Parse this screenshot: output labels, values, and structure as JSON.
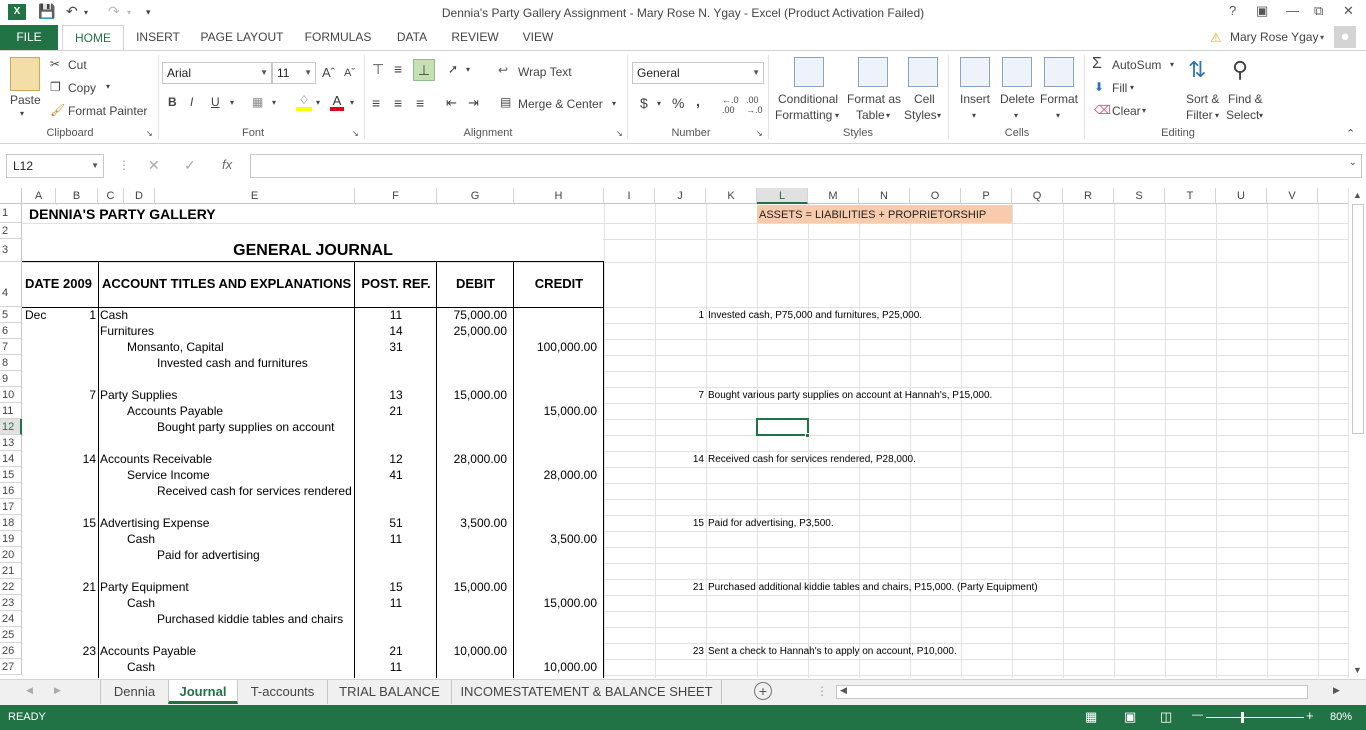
{
  "app": {
    "window_title": "Dennia's Party Gallery Assignment - Mary Rose N. Ygay - Excel (Product Activation Failed)",
    "user": "Mary Rose Ygay",
    "help": "?"
  },
  "ribbon_tabs": [
    "FILE",
    "HOME",
    "INSERT",
    "PAGE LAYOUT",
    "FORMULAS",
    "DATA",
    "REVIEW",
    "VIEW"
  ],
  "clipboard": {
    "paste": "Paste",
    "cut": "Cut",
    "copy": "Copy",
    "format_painter": "Format Painter",
    "label": "Clipboard"
  },
  "font": {
    "name": "Arial",
    "size": "11",
    "bold": "B",
    "italic": "I",
    "underline": "U",
    "label": "Font"
  },
  "alignment": {
    "wrap_text": "Wrap Text",
    "merge_center": "Merge & Center",
    "label": "Alignment"
  },
  "number": {
    "format": "General",
    "currency": "$",
    "percent": "%",
    "comma": ",",
    "label": "Number"
  },
  "styles": {
    "conditional": "Conditional",
    "conditional2": "Formatting",
    "format_as": "Format as",
    "format_as2": "Table",
    "cell": "Cell",
    "cell2": "Styles",
    "label": "Styles"
  },
  "cells": {
    "insert": "Insert",
    "delete": "Delete",
    "format": "Format",
    "label": "Cells"
  },
  "editing": {
    "autosum": "AutoSum",
    "fill": "Fill",
    "clear": "Clear",
    "sort": "Sort &",
    "sort2": "Filter",
    "find": "Find &",
    "find2": "Select",
    "label": "Editing"
  },
  "formula_bar": {
    "name_box": "L12",
    "fx": "fx",
    "value": ""
  },
  "columns": [
    "A",
    "B",
    "C",
    "D",
    "E",
    "F",
    "G",
    "H",
    "I",
    "J",
    "K",
    "L",
    "M",
    "N",
    "O",
    "P",
    "Q",
    "R",
    "S",
    "T",
    "U",
    "V"
  ],
  "rows": [
    "1",
    "2",
    "3",
    "4",
    "5",
    "6",
    "7",
    "8",
    "9",
    "10",
    "11",
    "12",
    "13",
    "14",
    "15",
    "16",
    "17",
    "18",
    "19",
    "20",
    "21",
    "22",
    "23",
    "24",
    "25",
    "26",
    "27"
  ],
  "sheet": {
    "company": "DENNIA'S PARTY GALLERY",
    "equation": "ASSETS = LIABILITIES + PROPRIETORSHIP",
    "journal_title": "GENERAL JOURNAL",
    "headers": {
      "date": "DATE 2009",
      "account": "ACCOUNT TITLES AND EXPLANATIONS",
      "post_ref": "POST. REF.",
      "debit": "DEBIT",
      "credit": "CREDIT"
    },
    "month": "Dec",
    "entries": [
      {
        "day": "1",
        "debit_acct": "Cash",
        "debit_ref": "11",
        "debit_amt": "75,000.00",
        "debit2_acct": "Furnitures",
        "debit2_ref": "14",
        "debit2_amt": "25,000.00",
        "credit_acct": "Monsanto, Capital",
        "credit_ref": "31",
        "credit_amt": "100,000.00",
        "explanation": "Invested cash and furnitures"
      },
      {
        "day": "7",
        "debit_acct": "Party Supplies",
        "debit_ref": "13",
        "debit_amt": "15,000.00",
        "credit_acct": "Accounts Payable",
        "credit_ref": "21",
        "credit_amt": "15,000.00",
        "explanation": "Bought party supplies on account"
      },
      {
        "day": "14",
        "debit_acct": "Accounts Receivable",
        "debit_ref": "12",
        "debit_amt": "28,000.00",
        "credit_acct": "Service Income",
        "credit_ref": "41",
        "credit_amt": "28,000.00",
        "explanation": "Received cash for services rendered"
      },
      {
        "day": "15",
        "debit_acct": "Advertising Expense",
        "debit_ref": "51",
        "debit_amt": "3,500.00",
        "credit_acct": "Cash",
        "credit_ref": "11",
        "credit_amt": "3,500.00",
        "explanation": "Paid for advertising"
      },
      {
        "day": "21",
        "debit_acct": "Party Equipment",
        "debit_ref": "15",
        "debit_amt": "15,000.00",
        "credit_acct": "Cash",
        "credit_ref": "11",
        "credit_amt": "15,000.00",
        "explanation": "Purchased kiddie tables and chairs"
      },
      {
        "day": "23",
        "debit_acct": "Accounts Payable",
        "debit_ref": "21",
        "debit_amt": "10,000.00",
        "credit_acct": "Cash",
        "credit_ref": "11",
        "credit_amt": "10,000.00",
        "explanation": ""
      }
    ],
    "transactions": [
      {
        "day": "1",
        "text": "Invested cash, P75,000 and furnitures, P25,000."
      },
      {
        "day": "7",
        "text": "Bought various party supplies on account at Hannah's, P15,000."
      },
      {
        "day": "14",
        "text": "Received cash for services rendered, P28,000."
      },
      {
        "day": "15",
        "text": "Paid for advertising, P3,500."
      },
      {
        "day": "21",
        "text": "Purchased additional kiddie tables and chairs, P15,000. (Party Equipment)"
      },
      {
        "day": "23",
        "text": "Sent a check to Hannah's to apply on account, P10,000."
      }
    ]
  },
  "sheet_tabs": [
    "Dennia",
    "Journal",
    "T-accounts",
    "TRIAL BALANCE",
    "INCOMESTATEMENT & BALANCE SHEET"
  ],
  "status": {
    "mode": "READY",
    "zoom": "80%"
  },
  "colors": {
    "excel_green": "#217346",
    "equation_fill": "#f8cbad"
  }
}
